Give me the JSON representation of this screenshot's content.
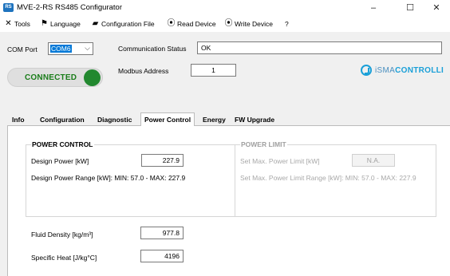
{
  "window": {
    "title": "MVE-2-RS RS485 Configurator",
    "app_icon_text": "RS",
    "minimize": "–",
    "maximize": "☐",
    "close": "✕"
  },
  "menu": {
    "tools": "Tools",
    "language": "Language",
    "config_file": "Configuration File",
    "read_device": "Read Device",
    "write_device": "Write Device",
    "help": "?"
  },
  "connection": {
    "com_port_label": "COM Port",
    "com_port_value": "COM6",
    "status_label": "Communication Status",
    "status_value": "OK",
    "modbus_label": "Modbus Address",
    "modbus_value": "1",
    "connected_text": "CONNECTED",
    "led_color": "#22882f"
  },
  "logo": {
    "brand_light": "iSMA",
    "brand_bold": "CONTROLLI"
  },
  "tabs": [
    "Info",
    "Configuration",
    "Diagnostic",
    "Power Control",
    "Energy",
    "FW Upgrade"
  ],
  "active_tab": "Power Control",
  "power_control": {
    "title": "POWER CONTROL",
    "design_power_label": "Design Power [kW]",
    "design_power_value": "227.9",
    "range_text": "Design Power Range [kW]: MIN: 57.0 - MAX: 227.9"
  },
  "power_limit": {
    "title": "POWER LIMIT",
    "set_max_label": "Set Max. Power Limit [kW]",
    "set_max_value": "N.A.",
    "range_text": "Set Max. Power Limit Range [kW]: MIN: 57.0 - MAX: 227.9"
  },
  "fluid": {
    "density_label": "Fluid Density [kg/m³]",
    "density_value": "977.8",
    "specific_heat_label": "Specific Heat [J/kg°C]",
    "specific_heat_value": "4196"
  }
}
